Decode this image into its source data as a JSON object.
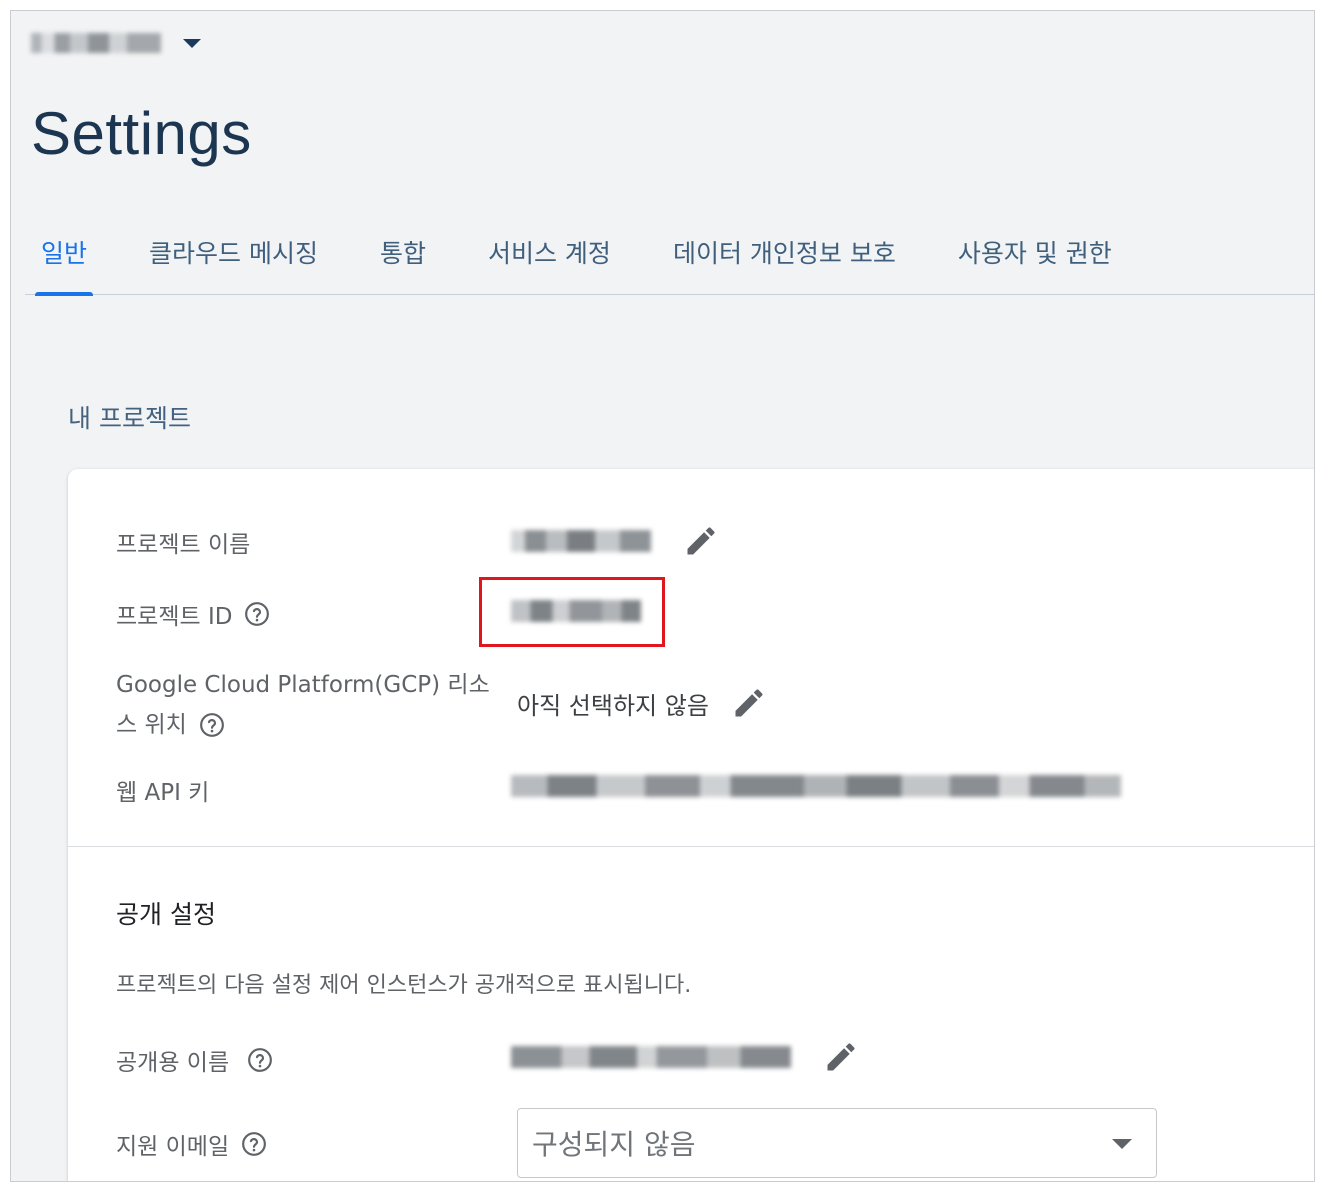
{
  "header": {
    "project_selector_value": "",
    "page_title": "Settings"
  },
  "tabs": [
    {
      "label": "일반",
      "active": true
    },
    {
      "label": "클라우드 메시징",
      "active": false
    },
    {
      "label": "통합",
      "active": false
    },
    {
      "label": "서비스 계정",
      "active": false
    },
    {
      "label": "데이터 개인정보 보호",
      "active": false
    },
    {
      "label": "사용자 및 권한",
      "active": false
    }
  ],
  "my_project": {
    "heading": "내 프로젝트",
    "fields": {
      "project_name": {
        "label": "프로젝트 이름",
        "value": ""
      },
      "project_id": {
        "label": "프로젝트 ID",
        "value": ""
      },
      "gcp_location": {
        "label_line1": "Google Cloud Platform(GCP) 리소",
        "label_line2": "스 위치",
        "value": "아직 선택하지 않음"
      },
      "web_api_key": {
        "label": "웹 API 키",
        "value": ""
      }
    }
  },
  "public_settings": {
    "heading": "공개 설정",
    "description": "프로젝트의 다음 설정 제어 인스턴스가 공개적으로 표시됩니다.",
    "public_name": {
      "label": "공개용 이름",
      "value": ""
    },
    "support_email": {
      "label": "지원 이메일",
      "selected": "구성되지 않음"
    }
  },
  "colors": {
    "accent": "#1a73e8",
    "highlight": "#e0161e",
    "title": "#1c3550"
  },
  "icons": [
    "caret-down-icon",
    "help-icon",
    "edit-pencil-icon"
  ]
}
